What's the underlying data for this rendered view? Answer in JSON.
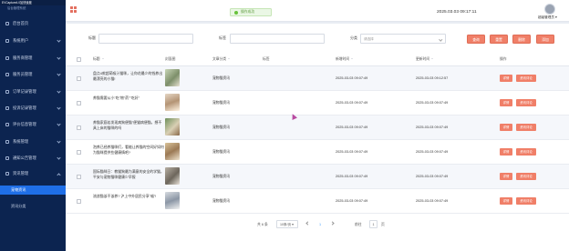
{
  "window": {
    "title": "EVCapture4.0加快速度"
  },
  "sidebar": {
    "subtitle": "后台管理系统",
    "items": [
      {
        "label": "后台首页",
        "icon": "home-icon"
      },
      {
        "label": "系统用户",
        "icon": "user-icon"
      },
      {
        "label": "服务商管理",
        "icon": "briefcase-icon"
      },
      {
        "label": "服务员管理",
        "icon": "staff-icon"
      },
      {
        "label": "订单记录管理",
        "icon": "order-icon"
      },
      {
        "label": "投诉记录管理",
        "icon": "complaint-icon"
      },
      {
        "label": "评价信息管理",
        "icon": "comment-icon"
      },
      {
        "label": "系统管理",
        "icon": "settings-icon"
      },
      {
        "label": "通知公告管理",
        "icon": "notice-icon"
      },
      {
        "label": "资讯管理",
        "icon": "flag-icon"
      }
    ],
    "sub_items": [
      {
        "label": "宠物资讯",
        "active": true
      },
      {
        "label": "资讯分类",
        "active": false
      }
    ]
  },
  "topbar": {
    "toast": "操作成功",
    "datetime": "2025.03.03 09:17:11",
    "user": "超级管理员"
  },
  "search": {
    "label_title": "标题",
    "label_tag": "标签",
    "label_category": "分类",
    "category_placeholder": "请选择",
    "buttons": [
      "查询",
      "重置",
      "删除",
      "添加"
    ]
  },
  "table": {
    "headers": {
      "title": "标题",
      "image": "封面图",
      "category": "文章分类",
      "tag": "标签",
      "created": "新增时间",
      "updated": "更新时间",
      "ops": "操作"
    },
    "rows": [
      {
        "title": "盘点4款超萌吸汁猫咪，让你花最少的钱养出最漂亮的小猫!",
        "category": "宠物猫资讯",
        "tag": "",
        "created": "2025-03-03 09:07:49",
        "updated": "2025-03-03 09:12:57"
      },
      {
        "title": "养猫需要从小\"吃\"物\"药\"\"吃好\"",
        "category": "宠物猫资讯",
        "tag": "",
        "created": "2025-03-03 09:07:49",
        "updated": "2025-03-03 09:07:49"
      },
      {
        "title": "养猫家庭若发现病狗便猫\"便猫病便猫，想不具上床的猫咪的吗",
        "category": "宠物猫资讯",
        "tag": "",
        "created": "2025-03-03 09:07:49",
        "updated": "2025-03-03 09:07:49"
      },
      {
        "title": "泡养已经养猫咪们，看能让养猫的空间好如何为猫咪提供些健康情吧?",
        "category": "宠物猫资讯",
        "tag": "",
        "created": "2025-03-03 09:07:49",
        "updated": "2025-03-03 09:07:49"
      },
      {
        "title": "国际猫咪日：教猫狗最为满意的安全的学猫，平安与宠物猫咪健康少早报",
        "category": "宠物猫资讯",
        "tag": "",
        "created": "2025-03-03 09:07:49",
        "updated": "2025-03-03 09:07:49"
      },
      {
        "title": "流浪猫该不该养? 沪上中外居民分享\"喵\"!",
        "category": "宠物猫资讯",
        "tag": "",
        "created": "2025-03-03 09:07:49",
        "updated": "2025-03-03 09:07:49"
      }
    ],
    "op_edit": "详情",
    "op_delete": "资讯评论"
  },
  "pagination": {
    "total": "共 6 条",
    "page_size": "10条/页",
    "current": "1",
    "goto": "前往",
    "goto_value": "1",
    "page_suffix": "页"
  },
  "colors": {
    "sidebar_bg": "#0c2450",
    "active_bg": "#1f6fe8",
    "accent": "#f07f68"
  }
}
